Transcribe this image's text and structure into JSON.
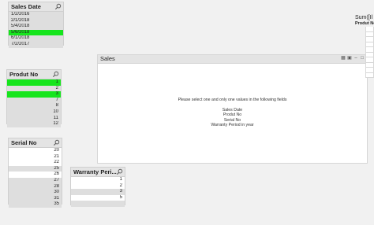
{
  "sales_date": {
    "title": "Sales Date",
    "items": [
      {
        "label": "1/2/2016",
        "state": "exc"
      },
      {
        "label": "2/1/2018",
        "state": "exc"
      },
      {
        "label": "5/4/2018",
        "state": "exc"
      },
      {
        "label": "5/6/2018",
        "state": "sel"
      },
      {
        "label": "6/1/2018",
        "state": "exc"
      },
      {
        "label": "7/2/2017",
        "state": "exc"
      }
    ]
  },
  "produt_no": {
    "title": "Produt No",
    "items": [
      {
        "label": "1",
        "state": "sel"
      },
      {
        "label": "2",
        "state": "exc"
      },
      {
        "label": "3",
        "state": "sel"
      },
      {
        "label": "7",
        "state": "exc"
      },
      {
        "label": "8",
        "state": "exc"
      },
      {
        "label": "10",
        "state": "exc"
      },
      {
        "label": "11",
        "state": "exc"
      },
      {
        "label": "12",
        "state": "exc"
      }
    ]
  },
  "serial_no": {
    "title": "Serial No",
    "items": [
      {
        "label": "20",
        "state": "opt"
      },
      {
        "label": "21",
        "state": "opt"
      },
      {
        "label": "22",
        "state": "opt"
      },
      {
        "label": "25",
        "state": "exc"
      },
      {
        "label": "26",
        "state": "opt"
      },
      {
        "label": "27",
        "state": "exc"
      },
      {
        "label": "28",
        "state": "exc"
      },
      {
        "label": "30",
        "state": "exc"
      },
      {
        "label": "31",
        "state": "exc"
      },
      {
        "label": "35",
        "state": "exc"
      }
    ]
  },
  "warranty": {
    "title": "Warranty Peri...",
    "items": [
      {
        "label": "1",
        "state": "opt"
      },
      {
        "label": "2",
        "state": "opt"
      },
      {
        "label": "3",
        "state": "exc"
      },
      {
        "label": "5",
        "state": "opt"
      },
      {
        "label": "",
        "state": "exc"
      }
    ]
  },
  "sales": {
    "title": "Sales",
    "message": "Please select one and only one values in the following fields",
    "fields": [
      "Sales Date",
      "Produt No",
      "Serial No",
      "Warranty Period in year"
    ],
    "icons": [
      "xl-icon",
      "restore-icon",
      "minimize-icon",
      "maximize-icon"
    ]
  },
  "sum_box": {
    "title": "Sum([Il",
    "column": "Produt No"
  },
  "colors": {
    "selected": "#16e51d",
    "excluded": "#dedede",
    "possible": "#ffffff"
  }
}
